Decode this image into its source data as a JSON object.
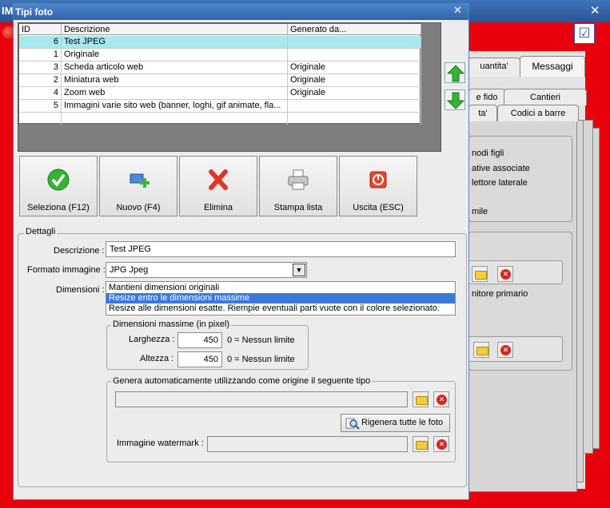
{
  "background_window": {
    "title": "IM",
    "close_glyph": "✕",
    "tabs_row1": [
      "uantita'",
      "Messaggi"
    ],
    "tabs_row2": [
      "e fido",
      "Cantieri"
    ],
    "tabs_row3": [
      "ta'",
      "Codici a barre"
    ],
    "texts": [
      "nodi figli",
      "ative associate",
      "lettore laterale",
      "mile",
      "nitore primario"
    ]
  },
  "dialog": {
    "title": "Tipi foto",
    "close_glyph": "✕"
  },
  "grid": {
    "columns": [
      "ID",
      "Descrizione",
      "Generato da..."
    ],
    "rows": [
      {
        "id": "6",
        "descrizione": "Test JPEG",
        "generato_da": "",
        "selected": true
      },
      {
        "id": "1",
        "descrizione": "Originale",
        "generato_da": ""
      },
      {
        "id": "3",
        "descrizione": "Scheda articolo web",
        "generato_da": "Originale"
      },
      {
        "id": "2",
        "descrizione": "Miniatura web",
        "generato_da": "Originale"
      },
      {
        "id": "4",
        "descrizione": "Zoom web",
        "generato_da": "Originale"
      },
      {
        "id": "5",
        "descrizione": "Immagini varie sito web (banner, loghi, gif animate, fla...",
        "generato_da": ""
      }
    ]
  },
  "toolbar": {
    "seleziona": "Seleziona (F12)",
    "nuovo": "Nuovo (F4)",
    "elimina": "Elimina",
    "stampa": "Stampa lista",
    "uscita": "Uscita (ESC)"
  },
  "dettagli": {
    "legend": "Dettagli",
    "descrizione_label": "Descrizione :",
    "descrizione_value": "Test JPEG",
    "formato_label": "Formato immagine :",
    "formato_value": "JPG Jpeg",
    "dimensioni_label": "Dimensioni :",
    "dimensioni_options": [
      "Mantieni dimensioni originali",
      "Resize entro le dimensioni massime",
      "Resize alle dimensioni esatte. Riempie eventuali parti vuote con il colore selezionato."
    ],
    "dimensioni_selected_index": 1
  },
  "dimensioni_massime": {
    "legend": "Dimensioni massime (in pixel)",
    "larghezza_label": "Larghezza :",
    "larghezza_value": "450",
    "larghezza_note": "0 = Nessun limite",
    "altezza_label": "Altezza :",
    "altezza_value": "450",
    "altezza_note": "0 = Nessun limite"
  },
  "genera": {
    "legend": "Genera automaticamente utilizzando come origine il seguente tipo",
    "origine_value": "",
    "rigenera_label": "Rigenera tutte le foto",
    "watermark_label": "Immagine watermark :",
    "watermark_value": ""
  },
  "colors": {
    "accent_red": "#e8000a",
    "titlebar_blue": "#2f64aa",
    "selected_row": "#a8e8ec",
    "selected_option": "#3c78d8"
  }
}
